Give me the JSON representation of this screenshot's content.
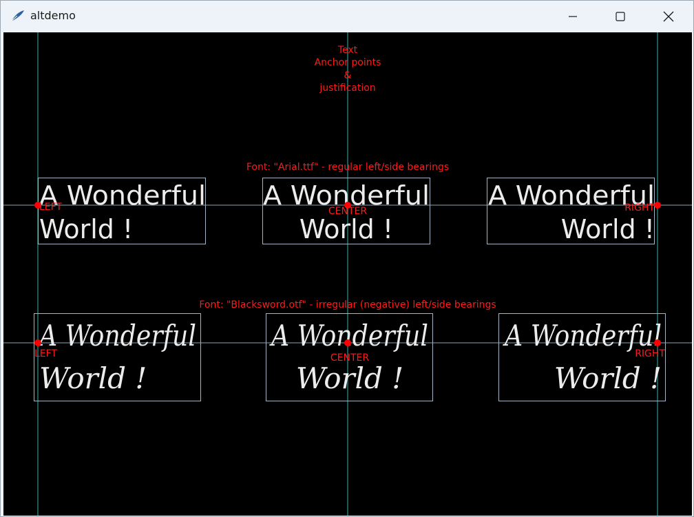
{
  "window": {
    "title": "altdemo"
  },
  "canvas": {
    "heading_lines": [
      "Text",
      "Anchor points",
      "&",
      "justification"
    ],
    "arial_caption": "Font: \"Arial.ttf\" - regular left/side bearings",
    "blacksword_caption": "Font: \"Blacksword.otf\" - irregular (negative) left/side bearings",
    "sample_line1": "A Wonderful",
    "sample_line2": "World !",
    "anchors": {
      "left": "LEFT",
      "center": "CENTER",
      "right": "RIGHT"
    },
    "colors": {
      "background": "#000000",
      "caption": "#ff1a1a",
      "anchor_dot": "#ff0000",
      "sample_text": "#ececec",
      "box": "#a7b7c8",
      "vertical_guide": "#2d8a8a",
      "horizontal_guide": "#8fa3b6"
    }
  }
}
